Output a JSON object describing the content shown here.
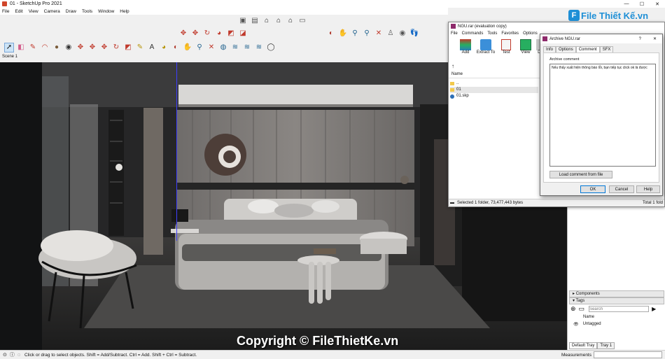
{
  "window": {
    "title": "01 - SketchUp Pro 2021",
    "controls": [
      "—",
      "☐",
      "✕"
    ]
  },
  "menu": [
    "File",
    "Edit",
    "View",
    "Camera",
    "Draw",
    "Tools",
    "Window",
    "Help"
  ],
  "scene_tab": "Scene 1",
  "statusbar": {
    "hint": "Click or drag to select objects. Shift = Add/Subtract. Ctrl = Add. Shift + Ctrl = Subtract.",
    "measurements_label": "Measurements"
  },
  "watermark": {
    "logo_text": "File Thiết Kế.vn",
    "copyright": "Copyright © FileThietKe.vn"
  },
  "winrar": {
    "title": "NGU.rar (evaluation copy)",
    "menu": [
      "File",
      "Commands",
      "Tools",
      "Favorites",
      "Options"
    ],
    "tools": [
      {
        "label": "Add",
        "icon": "add-archive-icon"
      },
      {
        "label": "Extract To",
        "icon": "extract-folder-icon"
      },
      {
        "label": "Test",
        "icon": "test-archive-icon"
      },
      {
        "label": "View",
        "icon": "view-book-icon"
      },
      {
        "label": "De",
        "icon": "delete-icon"
      }
    ],
    "column_name": "Name",
    "files": [
      "..",
      "01",
      "01.skp"
    ],
    "status_left": "Selected 1 folder, 73,477,443 bytes",
    "status_right": "Total 1 fold"
  },
  "dialog": {
    "title": "Archive NGU.rar",
    "help_mark": "?",
    "close_mark": "✕",
    "tabs": [
      "Info",
      "Options",
      "Comment",
      "SFX"
    ],
    "active_tab": "Comment",
    "comment_label": "Archive comment",
    "comment_text": "Nếu thấy xuất hiện thông báo lỗi, bạn tiếp tục click ok là được",
    "load_button": "Load comment from file",
    "ok": "OK",
    "cancel": "Cancel",
    "help": "Help"
  },
  "tray": {
    "sections": [
      {
        "label": "Components"
      },
      {
        "label": "Tags"
      }
    ],
    "search_placeholder": "Search",
    "tags_header": "Name",
    "tags": [
      "Untagged"
    ],
    "tabs": [
      "Default Tray",
      "Tray 1"
    ]
  },
  "colors": {
    "accent": "#0078d7",
    "logo_blue": "#1e8fd6",
    "logo_orange": "#f39c12"
  }
}
